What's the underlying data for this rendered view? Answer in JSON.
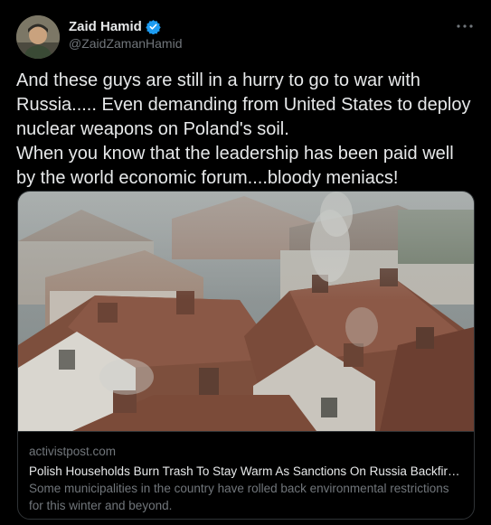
{
  "author": {
    "display_name": "Zaid Hamid",
    "handle": "@ZaidZamanHamid",
    "verified": true
  },
  "more_icon": "more-horizontal-icon",
  "tweet": {
    "text": "And these guys are still in a hurry to go to war with Russia..... Even demanding from United States to deploy nuclear weapons on Poland's soil.\nWhen you know that the leadership has been paid well by the world economic forum....bloody meniacs!"
  },
  "card": {
    "domain": "activistpost.com",
    "title": "Polish Households Burn Trash To Stay Warm As Sanctions On Russia Backfire -...",
    "description": "Some municipalities in the country have rolled back environmental restrictions for this winter and beyond."
  },
  "colors": {
    "background": "#000000",
    "text": "#e7e9ea",
    "muted": "#71767b",
    "border": "#2f3336",
    "verified": "#1d9bf0"
  }
}
